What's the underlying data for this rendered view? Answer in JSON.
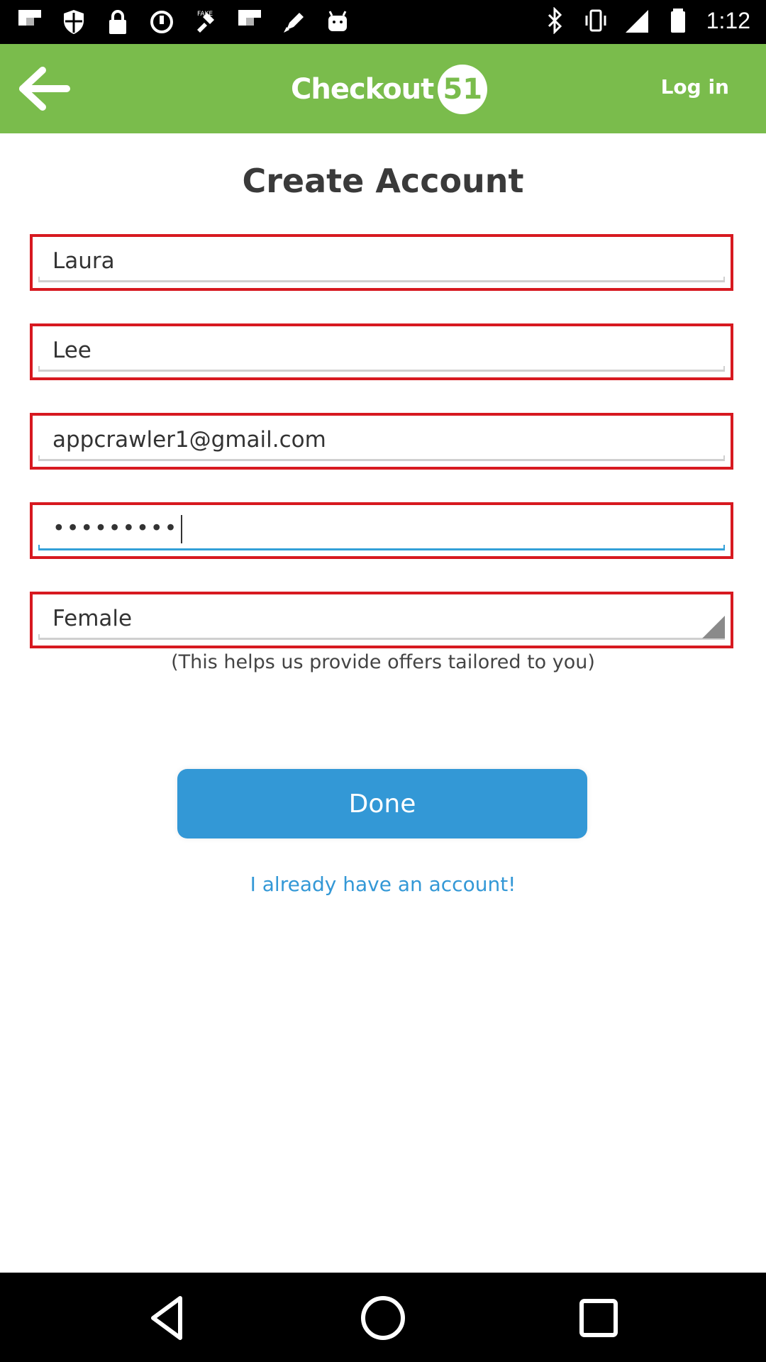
{
  "status_bar": {
    "time": "1:12",
    "left_icons": [
      "flipboard-icon",
      "shield-icon",
      "lock-icon",
      "sync-icon",
      "fake-gps-icon",
      "flipboard-icon",
      "pen-icon",
      "android-icon"
    ],
    "right_icons": [
      "bluetooth-icon",
      "vibrate-icon",
      "signal-icon",
      "battery-icon"
    ]
  },
  "app_bar": {
    "logo_text": "Checkout",
    "logo_number": "51",
    "login_label": "Log in",
    "color": "#7abc4c"
  },
  "form": {
    "title": "Create Account",
    "first_name": "Laura",
    "last_name": "Lee",
    "email": "appcrawler1@gmail.com",
    "password": "•••••••••",
    "gender": "Female",
    "helper_text": "(This helps us provide offers tailored to you)",
    "error_border_color": "#d71920"
  },
  "actions": {
    "done_label": "Done",
    "existing_account_label": "I already have an account!",
    "accent_color": "#3398d6"
  },
  "nav_bar": {
    "buttons": [
      "back-triangle-icon",
      "home-circle-icon",
      "recents-square-icon"
    ]
  }
}
